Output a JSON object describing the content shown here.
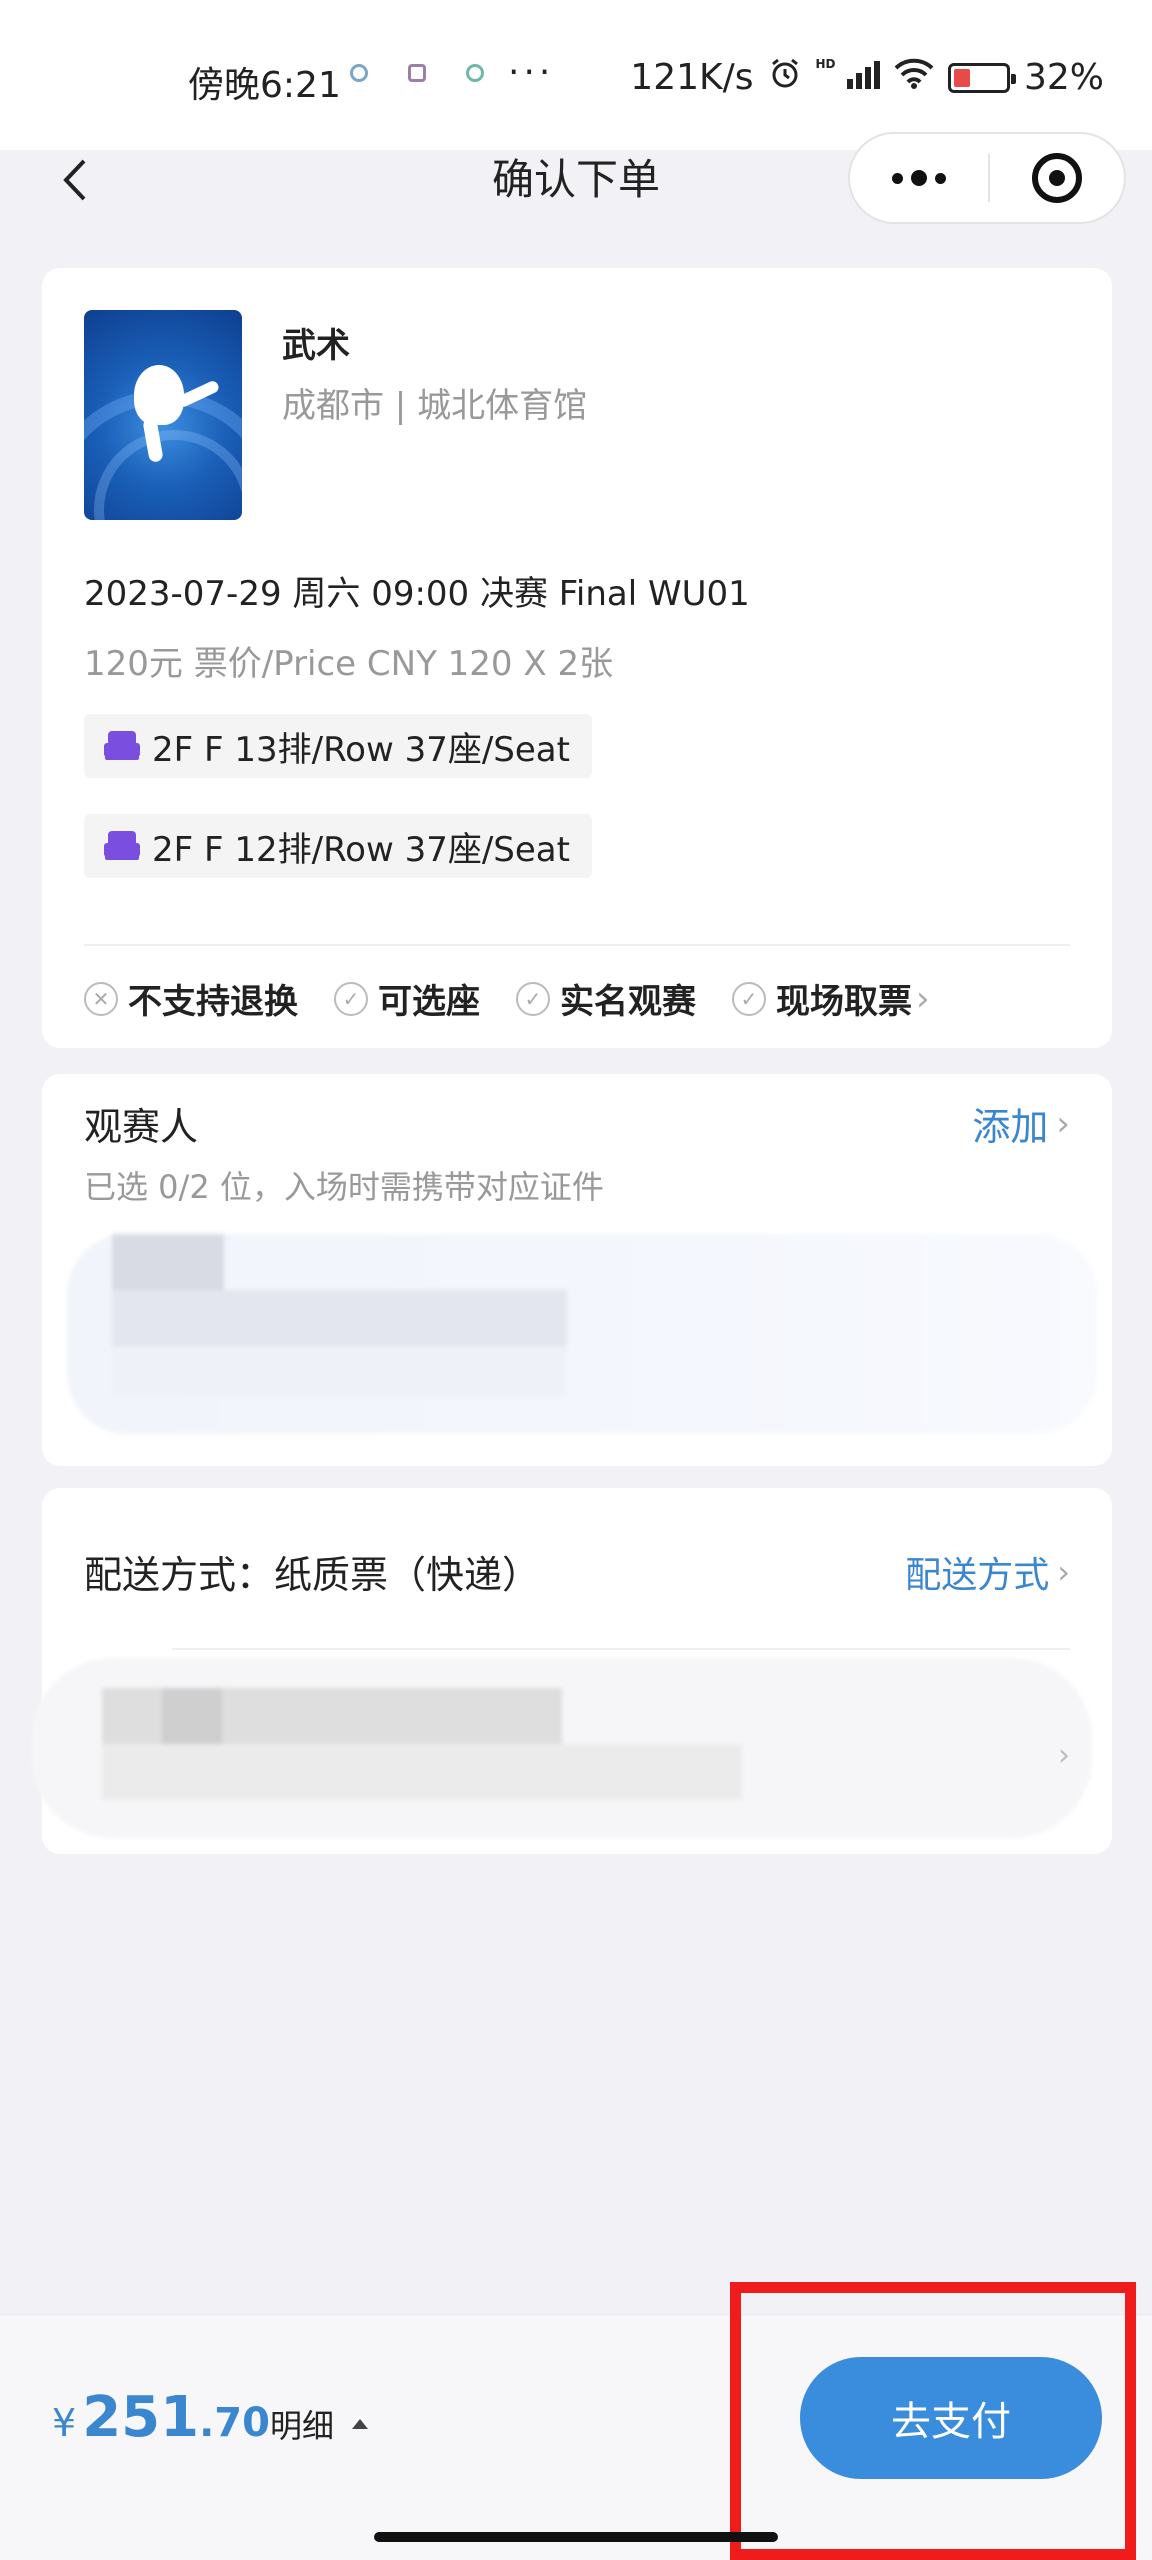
{
  "status_bar": {
    "time": "傍晚6:21",
    "more": "···",
    "speed": "121K/s",
    "battery": "32%",
    "hd": "HD"
  },
  "header": {
    "title": "确认下单",
    "back_icon": "chevron-left-icon",
    "more_icon": "more-dots-icon",
    "close_icon": "target-close-icon"
  },
  "event": {
    "title": "武术",
    "venue": "成都市 | 城北体育馆",
    "datetime": "2023-07-29 周六 09:00 决赛 Final WU01",
    "price_line": "120元 票价/Price CNY 120 X 2张",
    "seats": [
      "2F F 13排/Row 37座/Seat",
      "2F F 12排/Row 37座/Seat"
    ],
    "features": [
      {
        "label": "不支持退换",
        "icon": "x-circle-icon"
      },
      {
        "label": "可选座",
        "icon": "check-circle-icon"
      },
      {
        "label": "实名观赛",
        "icon": "check-circle-icon"
      },
      {
        "label": "现场取票",
        "icon": "check-circle-icon"
      }
    ]
  },
  "spectator": {
    "title": "观赛人",
    "hint": "已选 0/2 位，入场时需携带对应证件",
    "add_label": "添加"
  },
  "delivery": {
    "title": "配送方式：纸质票（快递）",
    "link_label": "配送方式"
  },
  "footer": {
    "currency": "¥",
    "amount_int": "251",
    "amount_dec": ".70",
    "detail_label": "明细",
    "pay_label": "去支付"
  }
}
